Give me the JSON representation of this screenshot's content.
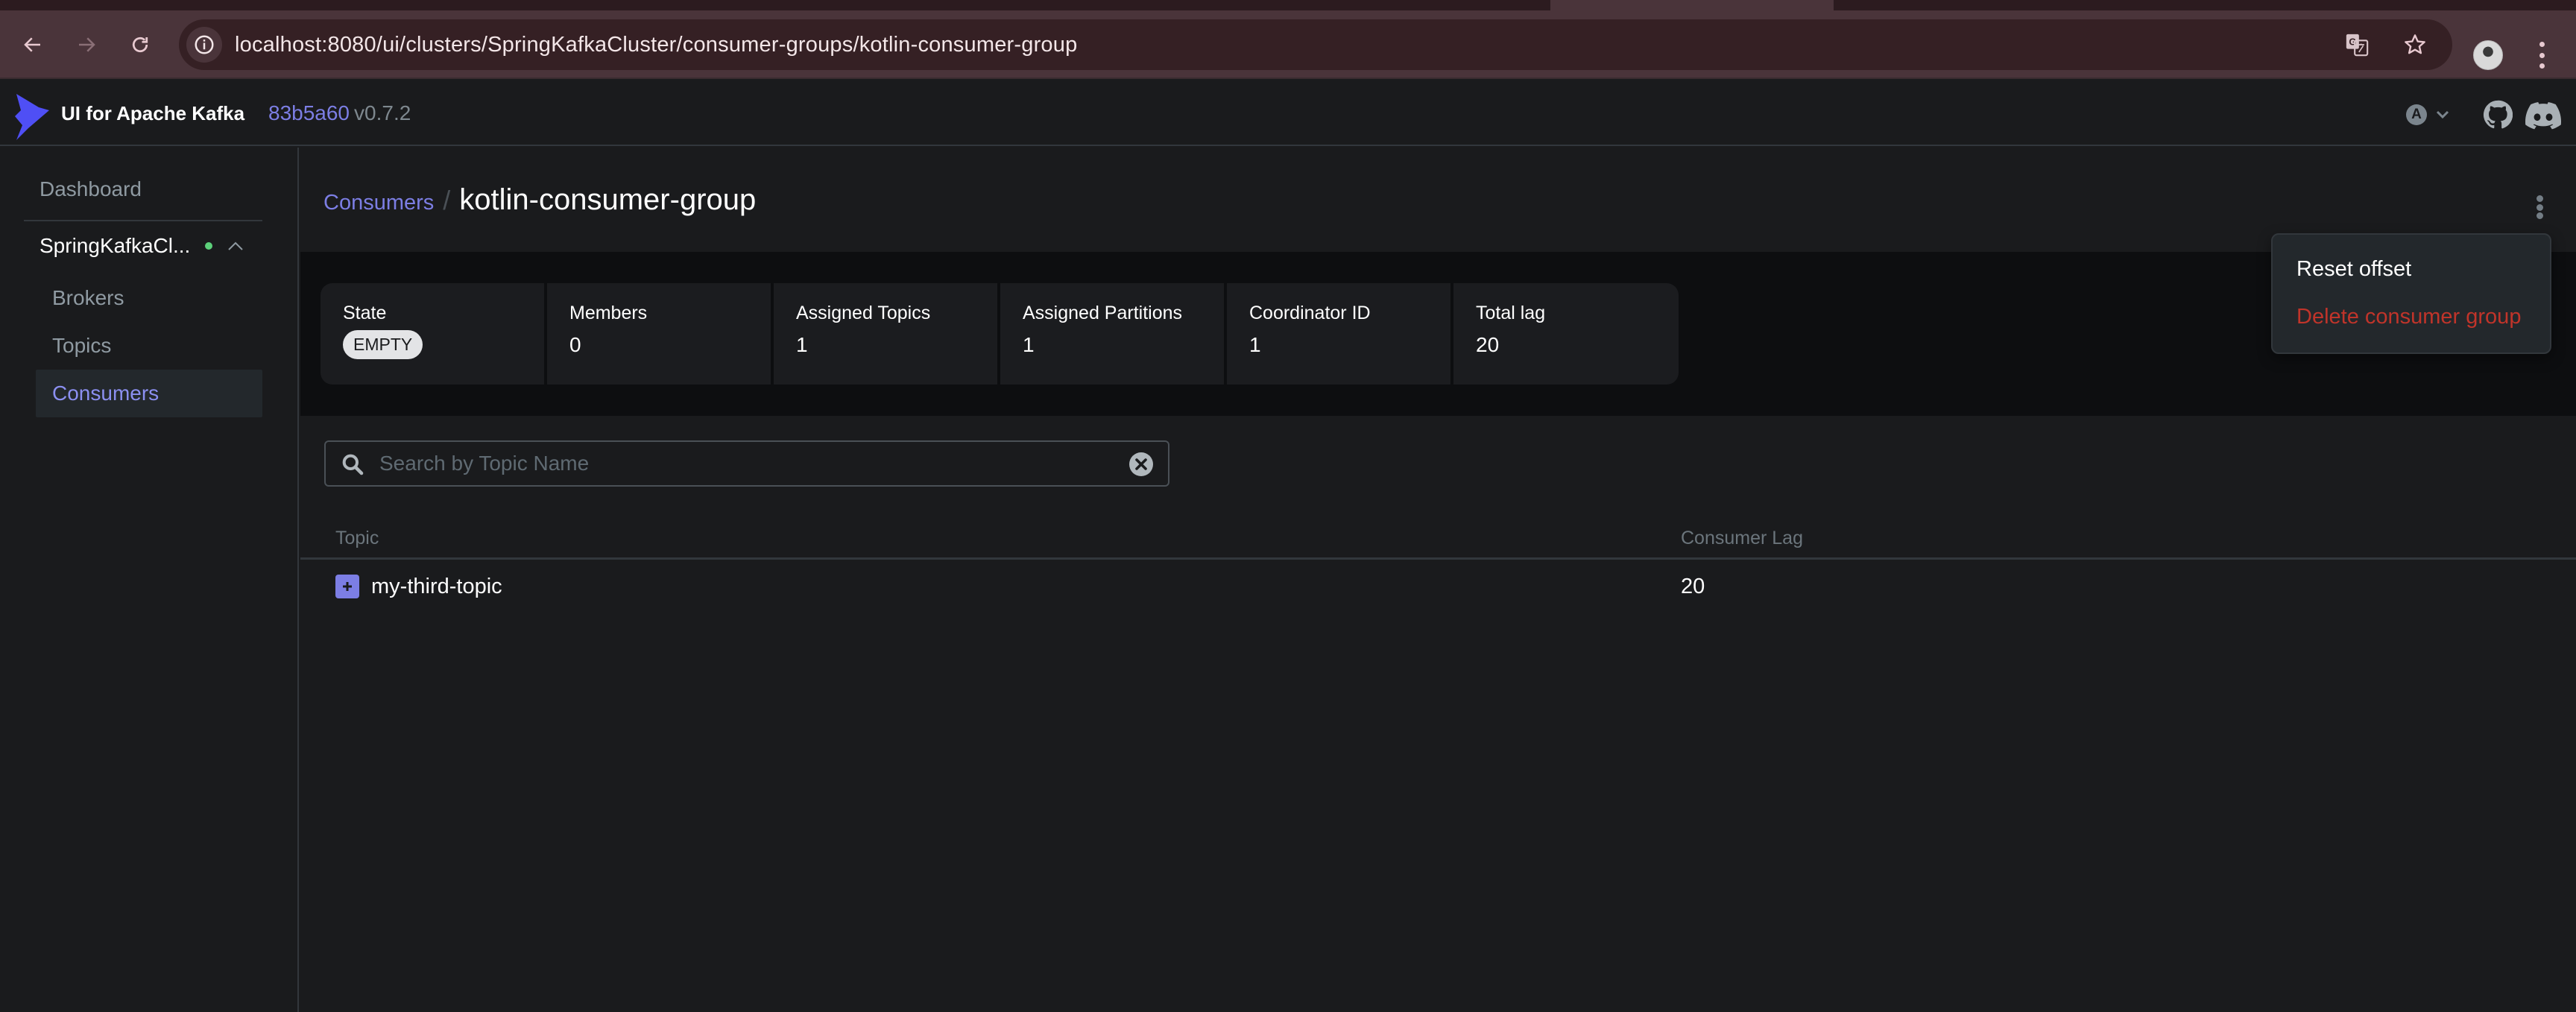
{
  "browser": {
    "url": "localhost:8080/ui/clusters/SpringKafkaCluster/consumer-groups/kotlin-consumer-group",
    "icons": [
      "back-icon",
      "forward-icon",
      "reload-icon",
      "site-info-icon",
      "translate-icon",
      "bookmark-star-icon",
      "profile-avatar",
      "browser-menu-icon"
    ]
  },
  "app": {
    "brand": "UI for Apache Kafka",
    "commit": "83b5a60",
    "version": "v0.7.2",
    "user_initial": "A",
    "accent_color": "#7c7ee4",
    "danger_color": "#c0342a",
    "status_online_color": "#5cd07a"
  },
  "sidebar": {
    "dashboard": "Dashboard",
    "cluster": {
      "name": "SpringKafkaCl...",
      "status": "online",
      "expanded": true
    },
    "items": [
      {
        "label": "Brokers",
        "active": false
      },
      {
        "label": "Topics",
        "active": false
      },
      {
        "label": "Consumers",
        "active": true
      }
    ]
  },
  "header": {
    "breadcrumb_parent": "Consumers",
    "separator": "/",
    "title": "kotlin-consumer-group"
  },
  "metrics": {
    "state": {
      "label": "State",
      "value": "EMPTY"
    },
    "members": {
      "label": "Members",
      "value": "0"
    },
    "assigned_topics": {
      "label": "Assigned Topics",
      "value": "1"
    },
    "assigned_partitions": {
      "label": "Assigned Partitions",
      "value": "1"
    },
    "coordinator_id": {
      "label": "Coordinator ID",
      "value": "1"
    },
    "total_lag": {
      "label": "Total lag",
      "value": "20"
    }
  },
  "search": {
    "placeholder": "Search by Topic Name",
    "value": ""
  },
  "table": {
    "columns": [
      "Topic",
      "Consumer Lag"
    ],
    "rows": [
      {
        "topic": "my-third-topic",
        "consumer_lag": "20"
      }
    ]
  },
  "actions_menu": {
    "open": true,
    "items": [
      {
        "label": "Reset offset",
        "variant": "default"
      },
      {
        "label": "Delete consumer group",
        "variant": "danger"
      }
    ]
  }
}
